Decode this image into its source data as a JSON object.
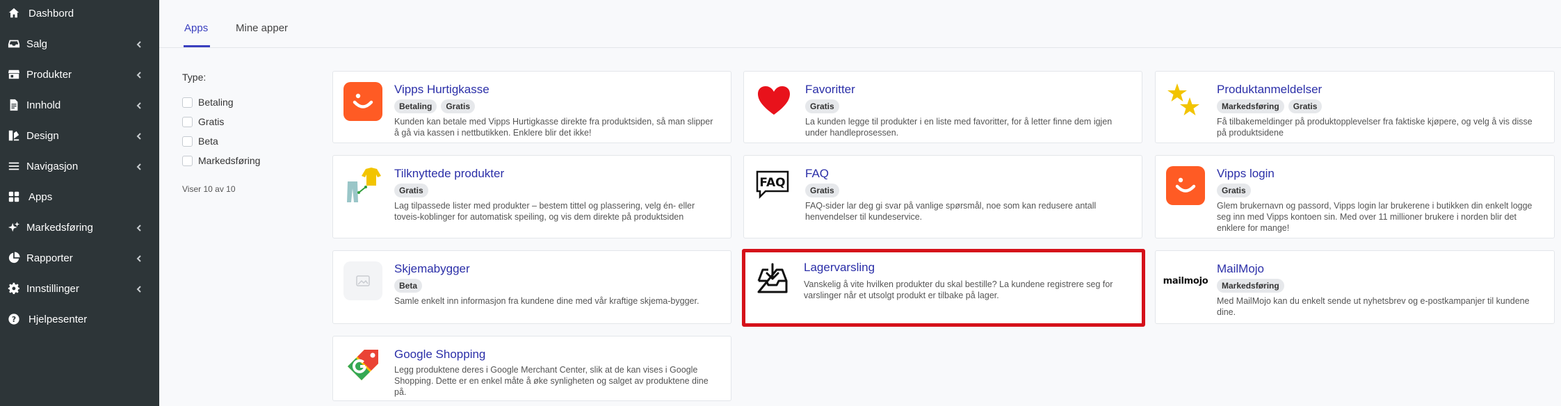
{
  "sidebar": {
    "items": [
      {
        "label": "Dashbord",
        "icon": "home-icon",
        "chevron": false
      },
      {
        "label": "Salg",
        "icon": "inbox-icon",
        "chevron": true
      },
      {
        "label": "Produkter",
        "icon": "store-icon",
        "chevron": true
      },
      {
        "label": "Innhold",
        "icon": "document-icon",
        "chevron": true
      },
      {
        "label": "Design",
        "icon": "palette-icon",
        "chevron": true
      },
      {
        "label": "Navigasjon",
        "icon": "menu-icon",
        "chevron": true
      },
      {
        "label": "Apps",
        "icon": "apps-icon",
        "chevron": false
      },
      {
        "label": "Markedsføring",
        "icon": "sparkles-icon",
        "chevron": true
      },
      {
        "label": "Rapporter",
        "icon": "pie-chart-icon",
        "chevron": true
      },
      {
        "label": "Innstillinger",
        "icon": "gear-icon",
        "chevron": true
      },
      {
        "label": "Hjelpesenter",
        "icon": "help-icon",
        "chevron": false
      }
    ]
  },
  "tabs": [
    {
      "label": "Apps",
      "active": true
    },
    {
      "label": "Mine apper",
      "active": false
    }
  ],
  "filter": {
    "title": "Type:",
    "options": [
      "Betaling",
      "Gratis",
      "Beta",
      "Markedsføring"
    ],
    "count_text": "Viser 10 av 10"
  },
  "colors": {
    "sidebar_bg": "#2d3538",
    "link": "#2b2fa8",
    "vipps": "#ff5b24",
    "highlight": "#d5111a"
  },
  "apps": [
    {
      "title": "Vipps Hurtigkasse",
      "badges": [
        "Betaling",
        "Gratis"
      ],
      "description": "Kunden kan betale med Vipps Hurtigkasse direkte fra produktsiden, så man slipper å gå via kassen i nettbutikken. Enklere blir det ikke!",
      "icon": "vipps-icon"
    },
    {
      "title": "Favoritter",
      "badges": [
        "Gratis"
      ],
      "description": "La kunden legge til produkter i en liste med favoritter, for å letter finne dem igjen under handleprosessen.",
      "icon": "heart-icon"
    },
    {
      "title": "Produktanmeldelser",
      "badges": [
        "Markedsføring",
        "Gratis"
      ],
      "description": "Få tilbakemeldinger på produktopplevelser fra faktiske kjøpere, og velg å vis disse på produktsidene",
      "icon": "stars-icon"
    },
    {
      "title": "Tilknyttede produkter",
      "badges": [
        "Gratis"
      ],
      "description": "Lag tilpassede lister med produkter – bestem tittel og plassering, velg én- eller toveis-koblinger for automatisk speiling, og vis dem direkte på produktsiden",
      "icon": "clothing-link-icon"
    },
    {
      "title": "FAQ",
      "badges": [
        "Gratis"
      ],
      "description": "FAQ-sider lar deg gi svar på vanlige spørsmål, noe som kan redusere antall henvendelser til kundeservice.",
      "icon": "faq-icon",
      "icon_text": "FAQ"
    },
    {
      "title": "Vipps login",
      "badges": [
        "Gratis"
      ],
      "description": "Glem brukernavn og passord, Vipps login lar brukerene i butikken din enkelt logge seg inn med Vipps kontoen sin. Med over 11 millioner brukere i norden blir det enklere for mange!",
      "icon": "vipps-icon"
    },
    {
      "title": "Skjemabygger",
      "badges": [
        "Beta"
      ],
      "description": "Samle enkelt inn informasjon fra kundene dine med vår kraftige skjema-bygger.",
      "icon": "image-placeholder-icon"
    },
    {
      "title": "Lagervarsling",
      "badges": [],
      "description": "Vanskelig å vite hvilken produkter du skal bestille? La kundene registrere seg for varslinger når et utsolgt produkt er tilbake på lager.",
      "icon": "inbox-download-icon"
    },
    {
      "title": "MailMojo",
      "badges": [
        "Markedsføring"
      ],
      "description": "Med MailMojo kan du enkelt sende ut nyhetsbrev og e-postkampanjer til kundene dine.",
      "icon": "mailmojo-logo",
      "icon_text": "mailmojo"
    },
    {
      "title": "Google Shopping",
      "badges": [],
      "description": "Legg produktene deres i Google Merchant Center, slik at de kan vises i Google Shopping. Dette er en enkel måte å øke synligheten og salget av produktene dine på.",
      "icon": "google-shopping-icon"
    }
  ]
}
